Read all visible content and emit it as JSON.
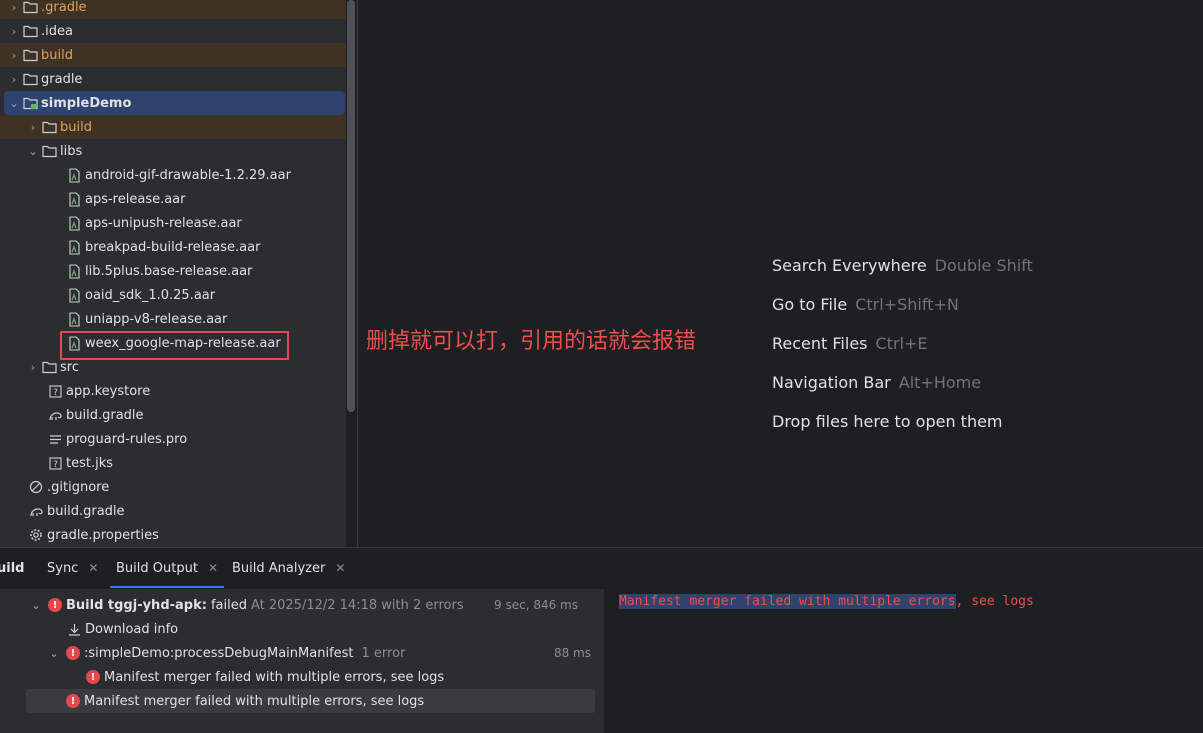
{
  "project_tree": {
    "items": [
      {
        "label": ".gradle",
        "icon": "folder-icon",
        "expanded": false,
        "excluded": true
      },
      {
        "label": ".idea",
        "icon": "folder-icon",
        "expanded": false
      },
      {
        "label": "build",
        "icon": "folder-icon",
        "expanded": false,
        "excluded": true
      },
      {
        "label": "gradle",
        "icon": "folder-icon",
        "expanded": false
      },
      {
        "label": "simpleDemo",
        "icon": "module-folder-icon",
        "expanded": true,
        "selected": true
      },
      {
        "label": "build",
        "icon": "folder-icon",
        "expanded": false,
        "excluded": true
      },
      {
        "label": "libs",
        "icon": "folder-icon",
        "expanded": true
      },
      {
        "label": "android-gif-drawable-1.2.29.aar",
        "icon": "aar-file-icon"
      },
      {
        "label": "aps-release.aar",
        "icon": "aar-file-icon"
      },
      {
        "label": "aps-unipush-release.aar",
        "icon": "aar-file-icon"
      },
      {
        "label": "breakpad-build-release.aar",
        "icon": "aar-file-icon"
      },
      {
        "label": "lib.5plus.base-release.aar",
        "icon": "aar-file-icon"
      },
      {
        "label": "oaid_sdk_1.0.25.aar",
        "icon": "aar-file-icon"
      },
      {
        "label": "uniapp-v8-release.aar",
        "icon": "aar-file-icon"
      },
      {
        "label": "weex_google-map-release.aar",
        "icon": "aar-file-icon"
      },
      {
        "label": "src",
        "icon": "folder-icon",
        "expanded": false
      },
      {
        "label": "app.keystore",
        "icon": "keystore-file-icon"
      },
      {
        "label": "build.gradle",
        "icon": "gradle-file-icon"
      },
      {
        "label": "proguard-rules.pro",
        "icon": "text-file-icon"
      },
      {
        "label": "test.jks",
        "icon": "keystore-file-icon"
      },
      {
        "label": ".gitignore",
        "icon": "ignore-file-icon"
      },
      {
        "label": "build.gradle",
        "icon": "gradle-file-icon"
      },
      {
        "label": "gradle.properties",
        "icon": "settings-file-icon"
      }
    ]
  },
  "annotation": {
    "text": "删掉就可以打，引用的话就会报错",
    "color": "#f14c4c"
  },
  "editor_hints": [
    {
      "action": "Search Everywhere",
      "shortcut": "Double Shift"
    },
    {
      "action": "Go to File",
      "shortcut": "Ctrl+Shift+N"
    },
    {
      "action": "Recent Files",
      "shortcut": "Ctrl+E"
    },
    {
      "action": "Navigation Bar",
      "shortcut": "Alt+Home"
    },
    {
      "action": "Drop files here to open them",
      "shortcut": ""
    }
  ],
  "build_window": {
    "title_partial": "uild",
    "tabs": [
      {
        "label": "Sync",
        "closable": true
      },
      {
        "label": "Build Output",
        "closable": true,
        "active": true
      },
      {
        "label": "Build Analyzer",
        "closable": true
      }
    ],
    "tree": {
      "root": {
        "label": "Build tggj-yhd-apk:",
        "status": "failed",
        "detail": "At 2025/12/2 14:18 with 2 errors",
        "duration": "9 sec, 846 ms"
      },
      "download": {
        "label": "Download info"
      },
      "task": {
        "label": ":simpleDemo:processDebugMainManifest",
        "detail": "1 error",
        "duration": "88 ms"
      },
      "task_error": {
        "label": "Manifest merger failed with multiple errors, see logs"
      },
      "error": {
        "label": "Manifest merger failed with multiple errors, see logs"
      }
    },
    "console": {
      "highlighted": "Manifest merger failed with multiple errors",
      "rest": ", see logs"
    }
  },
  "colors": {
    "error": "#e5484d",
    "selection": "#2e436e",
    "excluded_folder_bg": "#3d3223",
    "excluded_folder_text": "#e0a35c",
    "accent": "#3574f0"
  }
}
